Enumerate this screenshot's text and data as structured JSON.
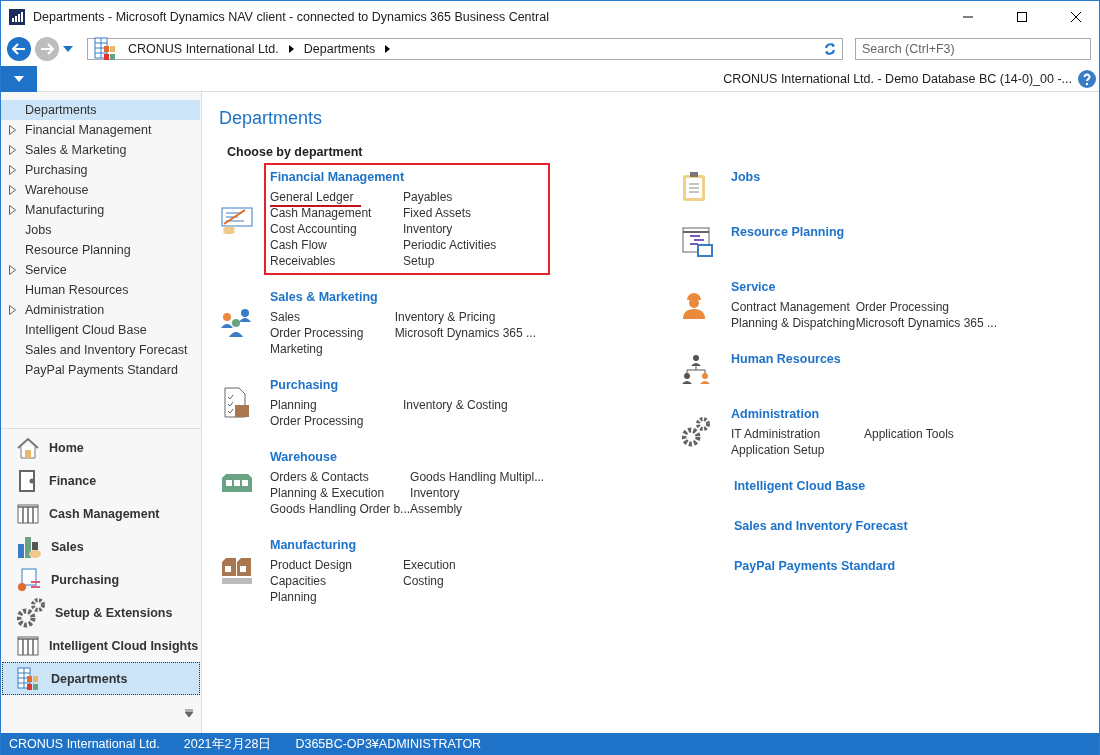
{
  "window": {
    "title": "Departments - Microsoft Dynamics NAV client - connected to Dynamics 365 Business Central"
  },
  "address": {
    "crumbs": [
      "CRONUS International Ltd.",
      "Departments"
    ]
  },
  "search": {
    "placeholder": "Search (Ctrl+F3)"
  },
  "connection": "CRONUS International Ltd. - Demo Database BC (14-0)_00 -...",
  "sidebar": {
    "items": [
      {
        "label": "Departments",
        "expandable": false,
        "selected": true
      },
      {
        "label": "Financial Management",
        "expandable": true,
        "selected": false
      },
      {
        "label": "Sales & Marketing",
        "expandable": true,
        "selected": false
      },
      {
        "label": "Purchasing",
        "expandable": true,
        "selected": false
      },
      {
        "label": "Warehouse",
        "expandable": true,
        "selected": false
      },
      {
        "label": "Manufacturing",
        "expandable": true,
        "selected": false
      },
      {
        "label": "Jobs",
        "expandable": false,
        "selected": false
      },
      {
        "label": "Resource Planning",
        "expandable": false,
        "selected": false
      },
      {
        "label": "Service",
        "expandable": true,
        "selected": false
      },
      {
        "label": "Human Resources",
        "expandable": false,
        "selected": false
      },
      {
        "label": "Administration",
        "expandable": true,
        "selected": false
      },
      {
        "label": "Intelligent Cloud Base",
        "expandable": false,
        "selected": false
      },
      {
        "label": "Sales and Inventory Forecast",
        "expandable": false,
        "selected": false
      },
      {
        "label": "PayPal Payments Standard",
        "expandable": false,
        "selected": false
      }
    ],
    "nav_buttons": [
      {
        "label": "Home",
        "selected": false
      },
      {
        "label": "Finance",
        "selected": false
      },
      {
        "label": "Cash Management",
        "selected": false
      },
      {
        "label": "Sales",
        "selected": false
      },
      {
        "label": "Purchasing",
        "selected": false
      },
      {
        "label": "Setup & Extensions",
        "selected": false
      },
      {
        "label": "Intelligent Cloud Insights",
        "selected": false
      },
      {
        "label": "Departments",
        "selected": true
      }
    ]
  },
  "page": {
    "title": "Departments",
    "subtitle": "Choose by department",
    "columns": [
      [
        {
          "kind": "section",
          "title": "Financial Management",
          "highlighted": true,
          "left": [
            {
              "label": "General Ledger",
              "underlined": true
            },
            {
              "label": "Cash Management",
              "underlined": false
            },
            {
              "label": "Cost Accounting",
              "underlined": false
            },
            {
              "label": "Cash Flow",
              "underlined": false
            },
            {
              "label": "Receivables",
              "underlined": false
            }
          ],
          "right": [
            {
              "label": "Payables",
              "underlined": false
            },
            {
              "label": "Fixed Assets",
              "underlined": false
            },
            {
              "label": "Inventory",
              "underlined": false
            },
            {
              "label": "Periodic Activities",
              "underlined": false
            },
            {
              "label": "Setup",
              "underlined": false
            }
          ]
        },
        {
          "kind": "section",
          "title": "Sales & Marketing",
          "highlighted": false,
          "left": [
            {
              "label": "Sales",
              "underlined": false
            },
            {
              "label": "Order Processing",
              "underlined": false
            },
            {
              "label": "Marketing",
              "underlined": false
            }
          ],
          "right": [
            {
              "label": "Inventory & Pricing",
              "underlined": false
            },
            {
              "label": "Microsoft Dynamics 365 ...",
              "underlined": false
            }
          ]
        },
        {
          "kind": "section",
          "title": "Purchasing",
          "highlighted": false,
          "left": [
            {
              "label": "Planning",
              "underlined": false
            },
            {
              "label": "Order Processing",
              "underlined": false
            }
          ],
          "right": [
            {
              "label": "Inventory & Costing",
              "underlined": false
            }
          ]
        },
        {
          "kind": "section",
          "title": "Warehouse",
          "highlighted": false,
          "left": [
            {
              "label": "Orders & Contacts",
              "underlined": false
            },
            {
              "label": "Planning & Execution",
              "underlined": false
            },
            {
              "label": "Goods Handling Order b...",
              "underlined": false
            }
          ],
          "right": [
            {
              "label": "Goods Handling Multipl...",
              "underlined": false
            },
            {
              "label": "Inventory",
              "underlined": false
            },
            {
              "label": "Assembly",
              "underlined": false
            }
          ]
        },
        {
          "kind": "section",
          "title": "Manufacturing",
          "highlighted": false,
          "left": [
            {
              "label": "Product Design",
              "underlined": false
            },
            {
              "label": "Capacities",
              "underlined": false
            },
            {
              "label": "Planning",
              "underlined": false
            }
          ],
          "right": [
            {
              "label": "Execution",
              "underlined": false
            },
            {
              "label": "Costing",
              "underlined": false
            }
          ]
        }
      ],
      [
        {
          "kind": "section",
          "title": "Jobs",
          "highlighted": false
        },
        {
          "kind": "section",
          "title": "Resource Planning",
          "highlighted": false
        },
        {
          "kind": "section",
          "title": "Service",
          "highlighted": false,
          "left": [
            {
              "label": "Contract Management",
              "underlined": false
            },
            {
              "label": "Planning & Dispatching",
              "underlined": false
            }
          ],
          "right": [
            {
              "label": "Order Processing",
              "underlined": false
            },
            {
              "label": "Microsoft Dynamics 365 ...",
              "underlined": false
            }
          ]
        },
        {
          "kind": "section",
          "title": "Human Resources",
          "highlighted": false
        },
        {
          "kind": "section",
          "title": "Administration",
          "highlighted": false,
          "left": [
            {
              "label": "IT Administration",
              "underlined": false
            },
            {
              "label": "Application Setup",
              "underlined": false
            }
          ],
          "right": [
            {
              "label": "Application Tools",
              "underlined": false
            }
          ]
        },
        {
          "kind": "link",
          "title": "Intelligent Cloud Base",
          "highlighted": false
        },
        {
          "kind": "link",
          "title": "Sales and Inventory Forecast",
          "highlighted": false
        },
        {
          "kind": "link",
          "title": "PayPal Payments Standard",
          "highlighted": false
        }
      ]
    ]
  },
  "status_bar": [
    "CRONUS International Ltd.",
    "2021年2月28日",
    "D365BC-OP3¥ADMINISTRATOR"
  ]
}
